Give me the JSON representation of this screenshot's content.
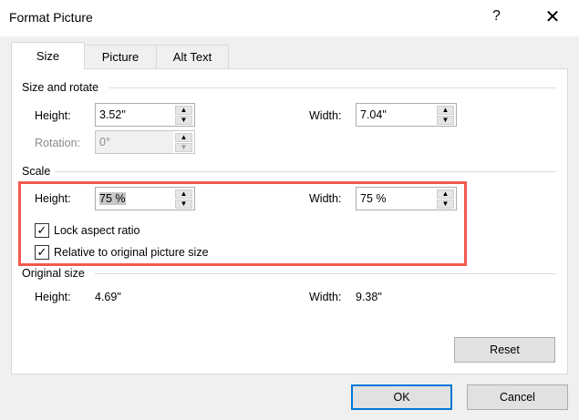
{
  "dialog": {
    "title": "Format Picture",
    "help": "?",
    "close": "✕"
  },
  "tabs": [
    {
      "label": "Size"
    },
    {
      "label": "Picture"
    },
    {
      "label": "Alt Text"
    }
  ],
  "size_and_rotate": {
    "heading": "Size and rotate",
    "height_label": "Height:",
    "height_value": "3.52\"",
    "width_label": "Width:",
    "width_value": "7.04\"",
    "rotation_label": "Rotation:",
    "rotation_value": "0°"
  },
  "scale": {
    "heading": "Scale",
    "height_label": "Height:",
    "height_value": "75 %",
    "width_label": "Width:",
    "width_value": "75 %",
    "lock_label": "Lock aspect ratio",
    "lock_checked": true,
    "relative_label": "Relative to original picture size",
    "relative_checked": true
  },
  "original": {
    "heading": "Original size",
    "height_label": "Height:",
    "height_value": "4.69\"",
    "width_label": "Width:",
    "width_value": "9.38\""
  },
  "buttons": {
    "reset": "Reset",
    "ok": "OK",
    "cancel": "Cancel"
  },
  "highlight_color": "#f25a50"
}
